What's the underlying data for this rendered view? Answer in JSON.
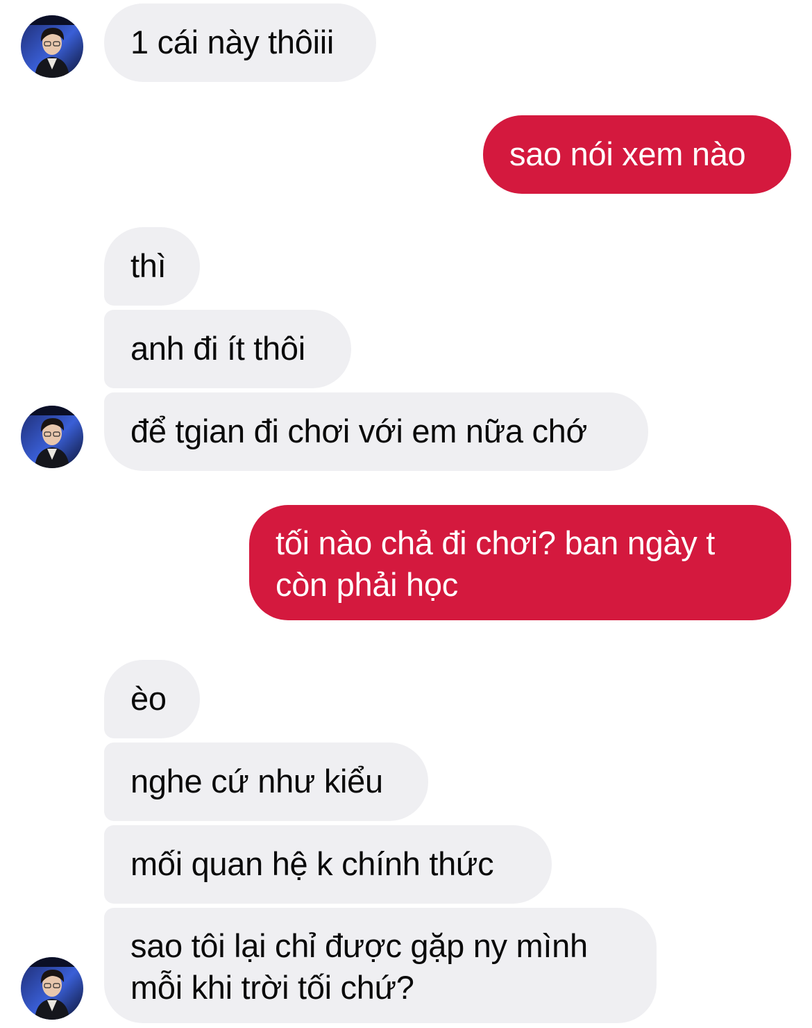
{
  "conversation": {
    "messages": [
      {
        "id": 1,
        "sender": "them",
        "text": "1 cái này thôiii"
      },
      {
        "id": 2,
        "sender": "me",
        "text": "sao nói xem nào"
      },
      {
        "id": 3,
        "sender": "them",
        "text": "thì"
      },
      {
        "id": 4,
        "sender": "them",
        "text": "anh đi ít thôi"
      },
      {
        "id": 5,
        "sender": "them",
        "text": "để tgian đi chơi với em nữa chớ"
      },
      {
        "id": 6,
        "sender": "me",
        "lines": [
          "tối nào chả đi chơi? ban ngày t",
          "còn phải học"
        ]
      },
      {
        "id": 7,
        "sender": "them",
        "text": "èo"
      },
      {
        "id": 8,
        "sender": "them",
        "text": "nghe cứ như kiểu"
      },
      {
        "id": 9,
        "sender": "them",
        "text": "mối quan hệ k chính thức"
      },
      {
        "id": 10,
        "sender": "them",
        "lines": [
          "sao tôi lại chỉ được gặp ny mình",
          "mỗi khi trời tối chứ?"
        ]
      }
    ]
  },
  "style": {
    "sent_bubble_color": "#d4193e",
    "received_bubble_color": "#efeff2",
    "sent_text_color": "#ffffff",
    "received_text_color": "#0a0a0a"
  },
  "icons": {
    "avatar": "contact-avatar-icon"
  }
}
